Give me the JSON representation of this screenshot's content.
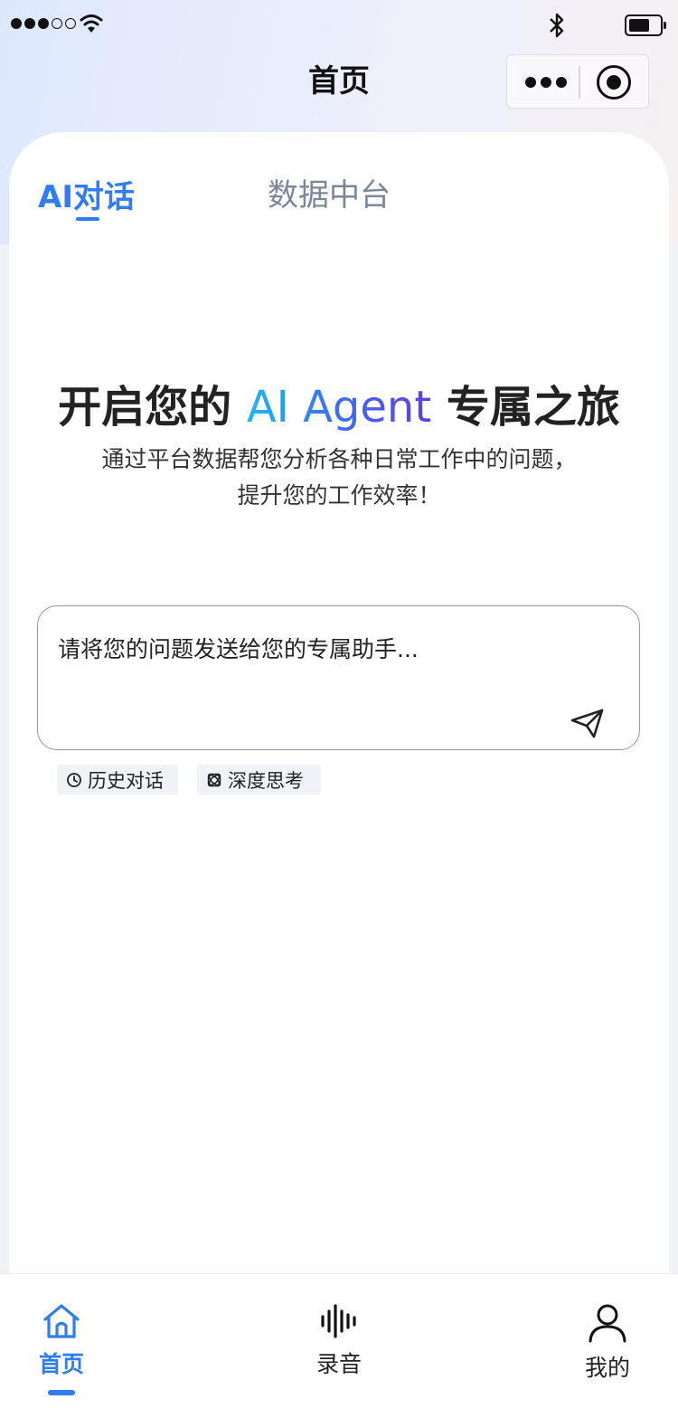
{
  "nav": {
    "title": "首页"
  },
  "tabs": [
    {
      "label": "AI对话",
      "active": true
    },
    {
      "label": "数据中台",
      "active": false
    }
  ],
  "hero": {
    "title_before": "开启您的 ",
    "title_highlight": "AI Agent",
    "title_after": " 专属之旅",
    "subtitle": "通过平台数据帮您分析各种日常工作中的问题，提升您的工作效率！"
  },
  "input": {
    "placeholder": "请将您的问题发送给您的专属助手..."
  },
  "chips": {
    "history": "历史对话",
    "deep_think": "深度思考"
  },
  "tabbar": {
    "home": "首页",
    "record": "录音",
    "me": "我的"
  },
  "colors": {
    "accent": "#2f7cf6",
    "tab_inactive": "#7b8698"
  },
  "icons": [
    "wifi-icon",
    "bluetooth-icon",
    "battery-icon",
    "more-icon",
    "record-icon",
    "send-icon",
    "clock-icon",
    "deep-think-icon",
    "home-icon",
    "waveform-icon",
    "person-icon"
  ]
}
